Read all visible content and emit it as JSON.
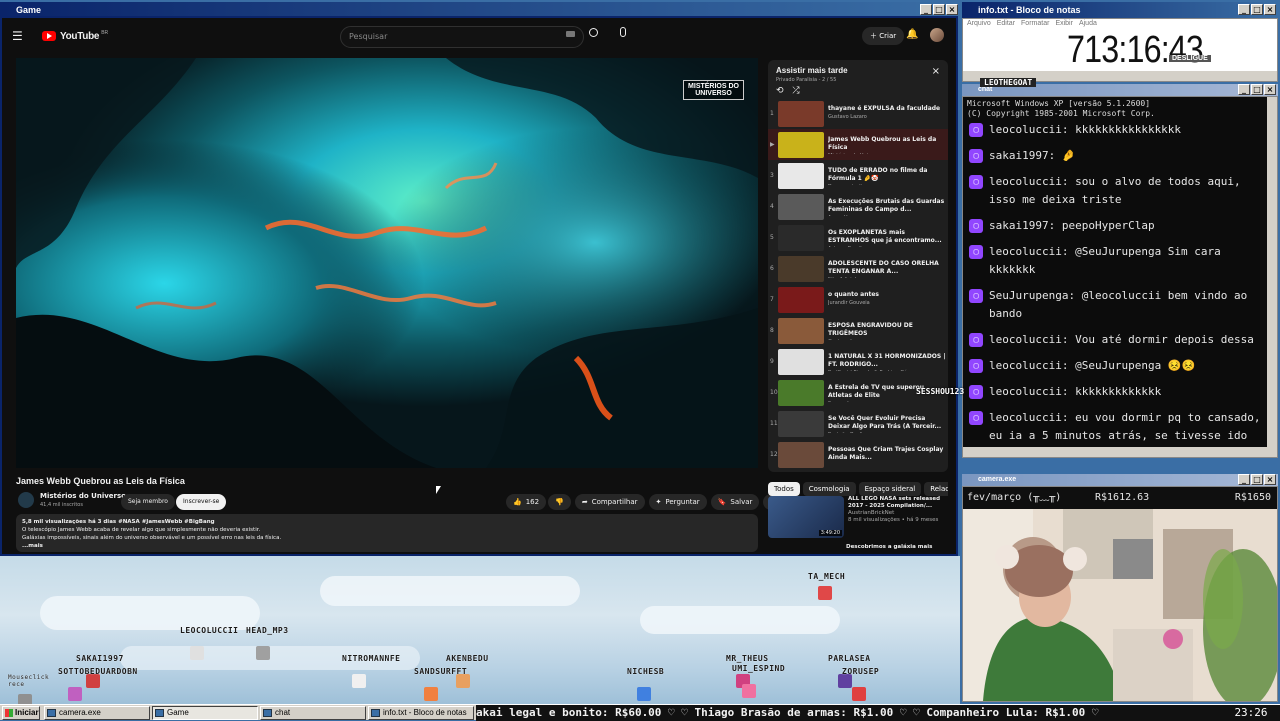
{
  "game_window": {
    "title": "Game"
  },
  "youtube": {
    "brand": "YouTube",
    "brand_suffix": "BR",
    "search_placeholder": "Pesquisar",
    "create_label": "Criar",
    "overlay_logo_line1": "MISTÉRIOS DO",
    "overlay_logo_line2": "UNIVERSO",
    "video_title": "James Webb Quebrou as Leis da Física",
    "channel_name": "Mistérios do Universo",
    "subscribers": "41,4 mil inscritos",
    "join_label": "Seja membro",
    "subscribe_label": "Inscrever-se",
    "likes": "162",
    "share_label": "Compartilhar",
    "ask_label": "Perguntar",
    "save_label": "Salvar",
    "views_line": "5,8 mil visualizações  há 3 dias  #NASA #JamesWebb #BigBang",
    "desc_line1": "O telescópio James Webb acaba de revelar algo que simplesmente não deveria existir.",
    "desc_line2": "Galáxias impossíveis, sinais além do universo observável e um possível erro nas leis da física.",
    "more_label": "...mais",
    "sidebar": {
      "title": "Assistir mais tarde",
      "subtitle": "Privado  Paralisia - 2 / 55",
      "items": [
        {
          "num": "1",
          "title": "thayane é EXPULSA da faculdade",
          "channel": "Gustavo Lazaro",
          "color": "#7a3a2a"
        },
        {
          "num": "▶",
          "title": "James Webb Quebrou as Leis da Física",
          "channel": "Mistérios do Universo",
          "color": "#c9b21a"
        },
        {
          "num": "3",
          "title": "TUDO de ERRADO no filme da Fórmula 1 🤌🤡",
          "channel": "Documentaril",
          "color": "#e8e8e8"
        },
        {
          "num": "4",
          "title": "As Execuções Brutais das Guardas Femininas do Campo d...",
          "channel": "Ago e Horrors",
          "color": "#5a5a5a"
        },
        {
          "num": "5",
          "title": "Os EXOPLANETAS mais ESTRANHOS que já encontramo...",
          "channel": "Astrum Brasil",
          "color": "#2a2a2a"
        },
        {
          "num": "6",
          "title": "ADOLESCENTE DO CASO ORELHA TENTA ENGANAR A...",
          "channel": "Não Adivinho",
          "color": "#4a3a2a"
        },
        {
          "num": "7",
          "title": "o quanto antes",
          "channel": "Jurandir Gouveia",
          "color": "#7a1a1a"
        },
        {
          "num": "8",
          "title": "ESPOSA ENGRAVIDOU DE TRIGÊMEOS",
          "channel": "Gustavo Lazaro",
          "color": "#8a5a3a"
        },
        {
          "num": "9",
          "title": "1 NATURAL X 31 HORMONIZADOS | FT. RODRIGO...",
          "channel": "RedCast | Ricardo & Rodrigo Góes",
          "color": "#e0e0e0"
        },
        {
          "num": "10",
          "title": "A Estrela de TV que superou Atletas de Elite",
          "channel": "Spremol",
          "color": "#4a7a2a"
        },
        {
          "num": "11",
          "title": "Se Você Quer Evoluir Precisa Deixar Algo Para Trás (A Terceir...",
          "channel": "Panteão Oculto",
          "color": "#3a3a3a"
        },
        {
          "num": "12",
          "title": "Pessoas Que Criam Trajes Cosplay Ainda Mais...",
          "channel": "",
          "color": "#6a4a3a"
        }
      ]
    },
    "chips": [
      "Todos",
      "Cosmologia",
      "Espaço sideral",
      "Relac"
    ],
    "rec": {
      "title": "ALL LEGO NASA sets released 2017 - 2025 Compilation/...",
      "channel": "AustrianBrickNet",
      "meta": "8 mil visualizações • há 9 meses",
      "duration": "3:49:20",
      "next_title": "Descobrimos a galáxia mais"
    }
  },
  "notepad": {
    "title": "info.txt - Bloco de notas",
    "menu": [
      "Arquivo",
      "Editar",
      "Formatar",
      "Exibir",
      "Ajuda"
    ],
    "timer": "713:16:43",
    "timer_badge": "DESLIGUE",
    "ticker_name": "LEOTHEGOAT"
  },
  "chat": {
    "title": "chat",
    "header1": "Microsoft Windows XP [versão 5.1.2600]",
    "header2": "(C) Copyright 1985-2001 Microsoft Corp.",
    "lines": [
      "leocoluccii: kkkkkkkkkkkkkkkk",
      "sakai1997: 🤌",
      "leocoluccii: sou o alvo de todos aqui, isso me deixa triste",
      "sakai1997: peepoHyperClap",
      "leocoluccii: @SeuJurupenga Sim cara kkkkkkk",
      "SeuJurupenga: @leocoluccii bem vindo ao bando",
      "leocoluccii: Vou até dormir depois dessa",
      "leocoluccii: @SeuJurupenga 😣😣",
      "leocoluccii: kkkkkkkkkkkkk",
      "leocoluccii: eu vou dormir pq to cansado, eu ia a 5 minutos atrás, se tivesse ido não teria tomado essa"
    ],
    "floating": "SESSHOU123"
  },
  "camera": {
    "title": "camera.exe",
    "label": "fev/março (╥﹏╥)",
    "amount1": "R$1612.63",
    "amount2": "R$1650"
  },
  "game": {
    "nicks": [
      "TA_MECH",
      "LEOCOLUCCII",
      "HEAD_MP3",
      "SAKAI1997",
      "SOTTOBEDUARDOBN",
      "NITROMANNFE",
      "AKENBEDU",
      "SANDSURFFT",
      "NICHESB",
      "MR_THEUS",
      "UMI_ESPIND",
      "PARLASEA",
      "ZORUSEP",
      "Mouseclick rece"
    ]
  },
  "taskbar": {
    "start": "Iniciar",
    "tasks": [
      "camera.exe",
      "Game",
      "chat",
      "info.txt - Bloco de notas"
    ],
    "ticker": "akai legal e bonito: R$60.00 ♡  ♡ Thiago Brasão de armas: R$1.00 ♡  ♡ Companheiro Lula: R$1.00 ♡",
    "clock": "23:26"
  }
}
